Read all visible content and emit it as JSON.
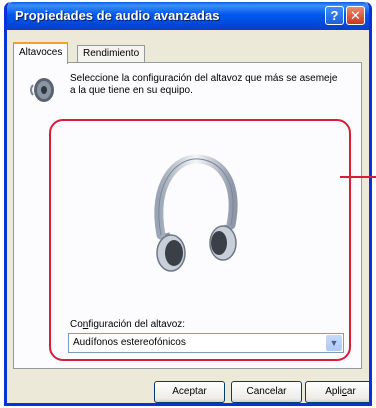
{
  "window": {
    "title": "Propiedades de audio avanzadas"
  },
  "titlebar_buttons": {
    "help": "?",
    "close": "✕"
  },
  "tabs": [
    {
      "label": "Altavoces",
      "active": true
    },
    {
      "label": "Rendimiento",
      "active": false
    }
  ],
  "panel": {
    "icon": "speaker-icon",
    "instruction": "Seleccione la configuración del altavoz que más se asemeje a la que tiene en su equipo.",
    "image": "headphones-icon",
    "config_label_prefix": "Co",
    "config_label_access": "n",
    "config_label_suffix": "figuración del altavoz:",
    "select_value": "Audífonos estereofónicos"
  },
  "buttons": {
    "ok": "Aceptar",
    "cancel": "Cancelar",
    "apply_prefix": "Apli",
    "apply_access": "c",
    "apply_suffix": "ar"
  },
  "colors": {
    "highlight": "#d81c3a",
    "titlebar": "#0058ee"
  }
}
